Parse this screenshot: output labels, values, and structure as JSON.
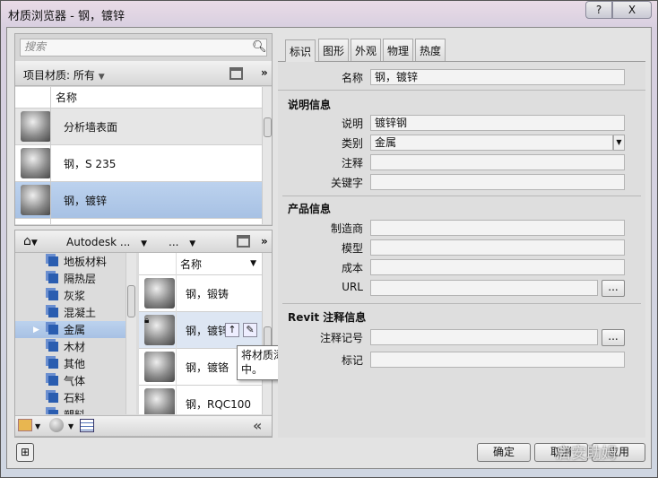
{
  "window": {
    "title": "材质浏览器 - 钢，镀锌",
    "help": "?",
    "close": "X"
  },
  "search": {
    "placeholder": "搜索"
  },
  "project": {
    "filter": "项目材质: 所有",
    "column": "名称",
    "items": [
      {
        "name": "分析墙表面"
      },
      {
        "name": "钢，S 235"
      },
      {
        "name": "钢，镀锌",
        "selected": true
      }
    ]
  },
  "library": {
    "breadcrumb": [
      "Autodesk ...",
      "..."
    ],
    "tree": [
      "地板材料",
      "隔热层",
      "灰浆",
      "混凝土",
      "金属",
      "木材",
      "其他",
      "气体",
      "石料",
      "塑料"
    ],
    "tree_selected": "金属",
    "column": "名称",
    "items": [
      {
        "name": "钢，锻铸"
      },
      {
        "name": "钢，镀锌"
      },
      {
        "name": "钢，镀铬"
      },
      {
        "name": "钢，RQC100"
      }
    ]
  },
  "tooltip": "将材质添加到文档中。",
  "tabs": [
    "标识",
    "图形",
    "外观",
    "物理",
    "热度"
  ],
  "form": {
    "name_label": "名称",
    "name_value": "钢，镀锌",
    "desc_section": "说明信息",
    "desc_label": "说明",
    "desc_value": "镀锌钢",
    "cat_label": "类别",
    "cat_value": "金属",
    "comment_label": "注释",
    "keyword_label": "关键字",
    "product_section": "产品信息",
    "mfr_label": "制造商",
    "model_label": "模型",
    "cost_label": "成本",
    "url_label": "URL",
    "revit_section": "Revit 注释信息",
    "keynote_label": "注释记号",
    "mark_label": "标记",
    "browse": "..."
  },
  "buttons": {
    "ok": "确定",
    "cancel": "取消",
    "apply": "应用"
  },
  "more": "»",
  "collapse": "«",
  "watermark": "启安助姆"
}
